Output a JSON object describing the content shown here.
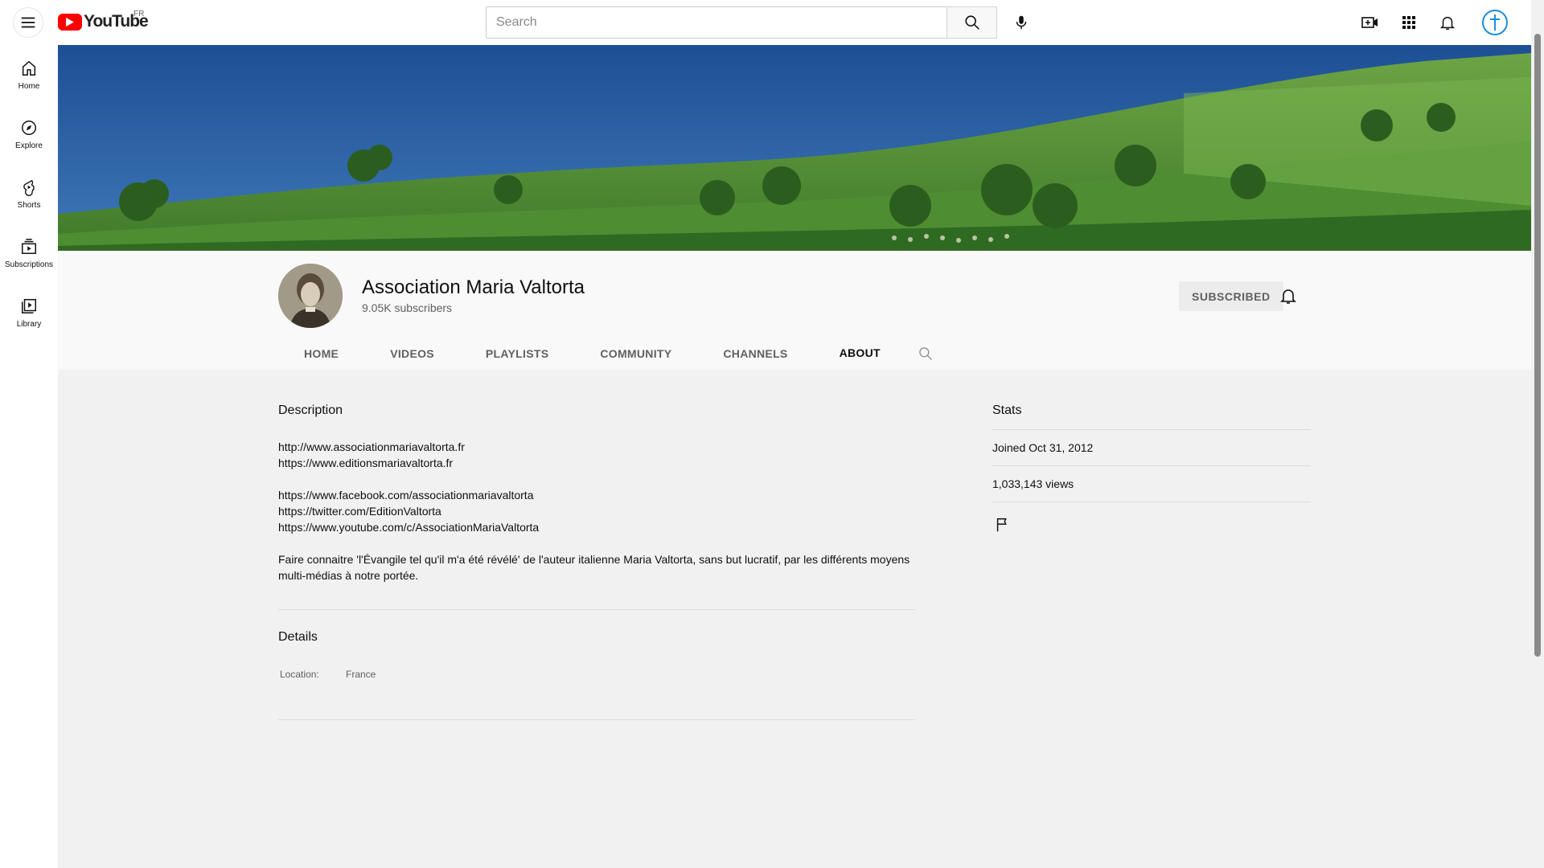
{
  "masthead": {
    "logo_text": "YouTube",
    "region": "FR",
    "search_placeholder": "Search",
    "icons": [
      "menu-icon",
      "search-icon",
      "mic-icon",
      "create-icon",
      "apps-icon",
      "notifications-icon"
    ]
  },
  "guide": {
    "items": [
      {
        "label": "Home",
        "icon": "home-icon"
      },
      {
        "label": "Explore",
        "icon": "explore-icon"
      },
      {
        "label": "Shorts",
        "icon": "shorts-icon"
      },
      {
        "label": "Subscriptions",
        "icon": "subscriptions-icon"
      },
      {
        "label": "Library",
        "icon": "library-icon"
      }
    ]
  },
  "channel": {
    "name": "Association Maria Valtorta",
    "subscribers": "9.05K subscribers",
    "subscribe_label": "SUBSCRIBED",
    "tabs": [
      "HOME",
      "VIDEOS",
      "PLAYLISTS",
      "COMMUNITY",
      "CHANNELS",
      "ABOUT"
    ],
    "active_tab": "ABOUT"
  },
  "about": {
    "description_title": "Description",
    "links_a": [
      "http://www.associationmariavaltorta.fr",
      "https://www.editionsmariavaltorta.fr"
    ],
    "links_b": [
      "https://www.facebook.com/associationmariavaltorta",
      "https://twitter.com/EditionValtorta",
      "https://www.youtube.com/c/AssociationMariaValtorta"
    ],
    "description_text": "Faire connaitre 'l'Évangile tel qu'il m'a été révélé' de l'auteur italienne Maria Valtorta, sans but lucratif, par les différents moyens multi-médias à notre portée.",
    "details_title": "Details",
    "location_label": "Location:",
    "location_value": "France",
    "stats_title": "Stats",
    "joined": "Joined Oct 31, 2012",
    "views": "1,033,143 views"
  },
  "colors": {
    "brand_red": "#ff0000",
    "text_primary": "#0f0f0f",
    "text_secondary": "#606060",
    "content_bg": "#f1f1f1",
    "header_bg": "#f9f9f9"
  }
}
